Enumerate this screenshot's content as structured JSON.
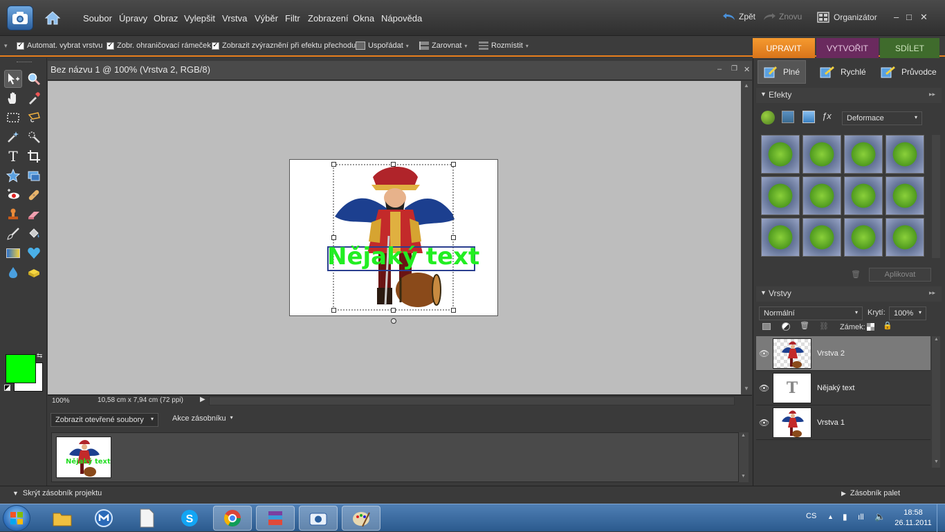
{
  "menubar": {
    "items": [
      "Soubor",
      "Úpravy",
      "Obraz",
      "Vylepšit",
      "Vrstva",
      "Výběr",
      "Filtr",
      "Zobrazení",
      "Okna",
      "Nápověda"
    ],
    "undo": "Zpět",
    "redo": "Znovu",
    "organizer": "Organizátor"
  },
  "options": {
    "auto_select": "Automat. vybrat vrstvu",
    "show_bbox": "Zobr. ohraničovací rámeček",
    "show_highlight": "Zobrazit zvýraznění při efektu přechodu",
    "arrange": "Uspořádat",
    "align": "Zarovnat",
    "distribute": "Rozmístit"
  },
  "modes": {
    "edit": "UPRAVIT",
    "create": "VYTVOŘIT",
    "share": "SDÍLET"
  },
  "edit_modes": {
    "full": "Plné",
    "quick": "Rychlé",
    "guided": "Průvodce"
  },
  "document": {
    "title": "Bez názvu 1 @ 100% (Vrstva 2, RGB/8)",
    "zoom": "100%",
    "dimensions": "10,58 cm x 7,94 cm (72 ppi)",
    "canvas_text": "Nějaký text"
  },
  "colors": {
    "foreground": "#00ff00",
    "background": "#ffffff",
    "accent": "#e87e1c"
  },
  "project_bin": {
    "show_files": "Zobrazit otevřené soubory",
    "actions": "Akce zásobníku",
    "thumb_text": "Nějaký text"
  },
  "bottom": {
    "hide_bin": "Skrýt zásobník projektu",
    "palette_bin": "Zásobník palet"
  },
  "effects": {
    "title": "Efekty",
    "category": "Deformace",
    "apply": "Aplikovat"
  },
  "layers": {
    "title": "Vrstvy",
    "blend_mode": "Normální",
    "opacity_label": "Krytí:",
    "opacity": "100%",
    "lock_label": "Zámek:",
    "items": [
      {
        "name": "Vrstva 2",
        "selected": true
      },
      {
        "name": "Nějaký text",
        "selected": false
      },
      {
        "name": "Vrstva 1",
        "selected": false
      }
    ]
  },
  "taskbar": {
    "lang": "CS",
    "time": "18:58",
    "date": "26.11.2011"
  }
}
